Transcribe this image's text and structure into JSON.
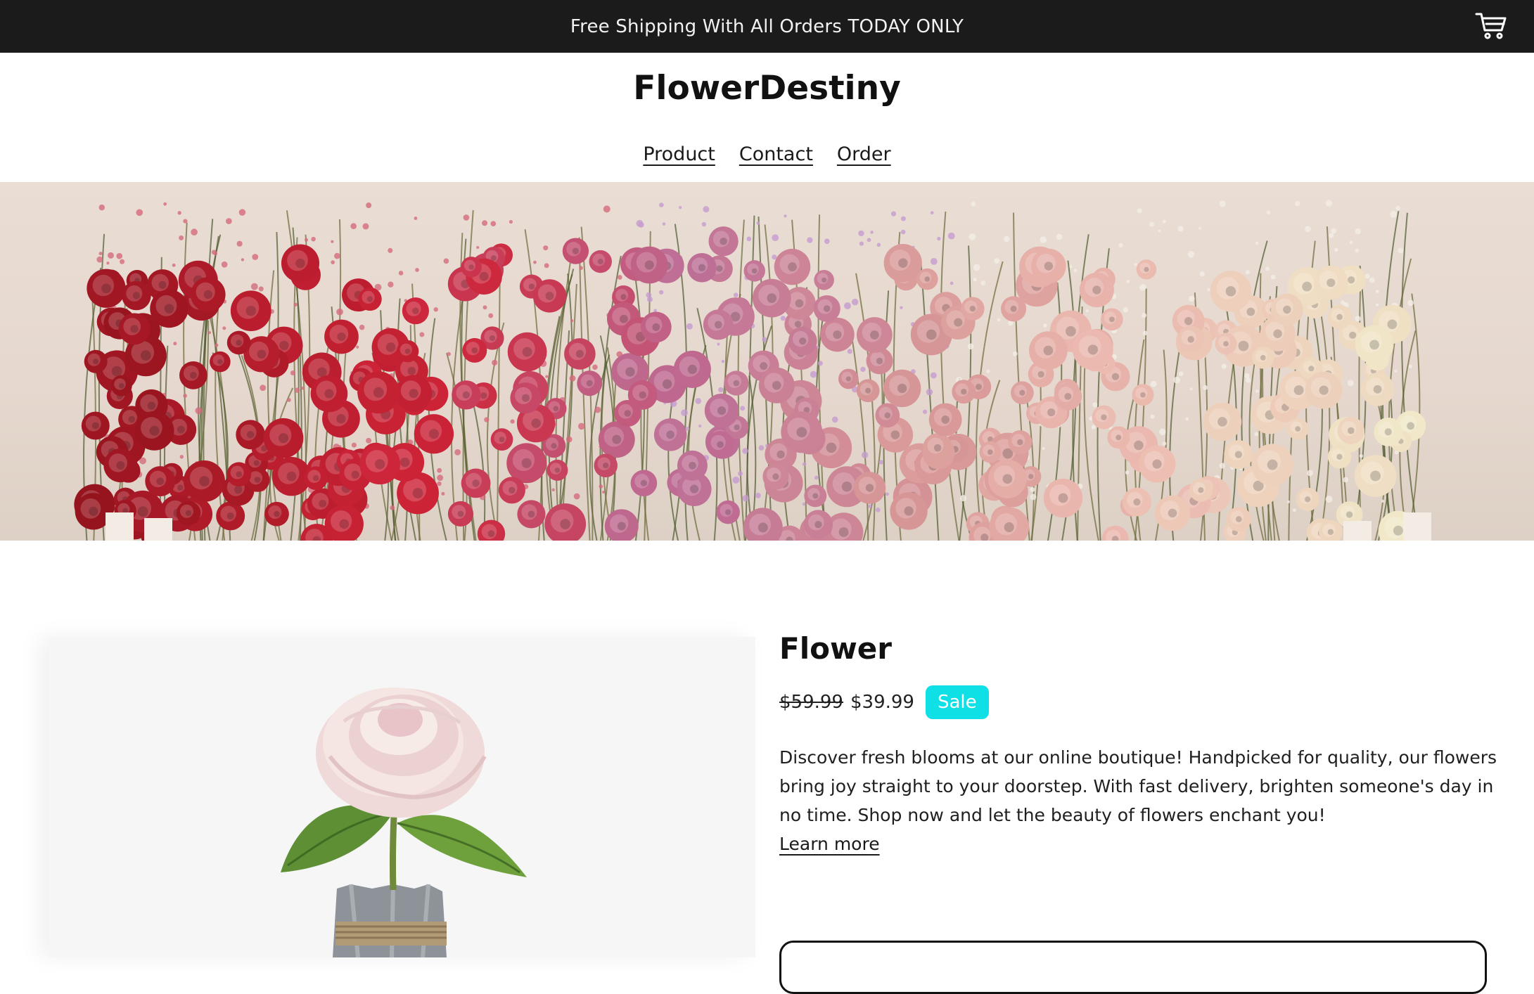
{
  "announcement": {
    "text": "Free Shipping With All Orders TODAY ONLY"
  },
  "header": {
    "brand": "FlowerDestiny",
    "nav": [
      {
        "label": "Product"
      },
      {
        "label": "Contact"
      },
      {
        "label": "Order"
      }
    ]
  },
  "product": {
    "title": "Flower",
    "compare_price": "$59.99",
    "price": "$39.99",
    "badge": "Sale",
    "description": "Discover fresh blooms at our online boutique! Handpicked for quality, our flowers bring joy straight to your doorstep. With fast delivery, brighten someone's day in no time. Shop now and let the beauty of flowers enchant you!",
    "learn_more": "Learn more"
  },
  "colors": {
    "announcement_bg": "#1b1b1b",
    "sale_badge": "#0fe0e6",
    "page_bg": "#ffffff"
  },
  "icons": {
    "cart": "cart-icon"
  }
}
